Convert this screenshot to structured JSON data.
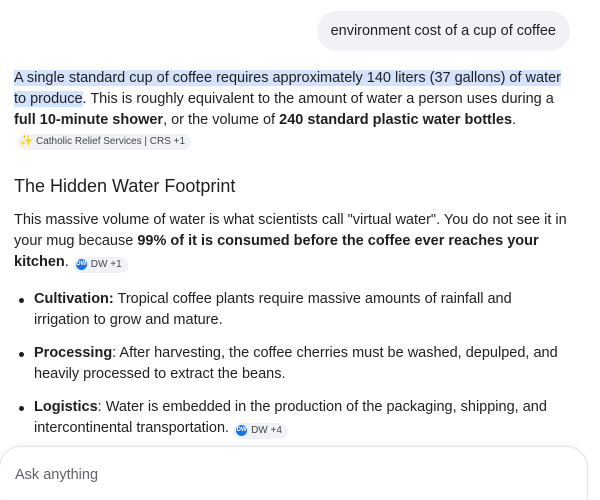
{
  "user_query": "environment cost of a cup of coffee",
  "answer": {
    "intro": {
      "highlight": "A single standard cup of coffee requires approximately 140 liters (37 gallons) of water to produce",
      "text1": ". This is roughly equivalent to the amount of water a person uses during a ",
      "bold1": "full 10-minute shower",
      "text2": ", or the volume of ",
      "bold2": "240 standard plastic water bottles",
      "text3": "."
    },
    "intro_citation": {
      "icon": "crs-icon",
      "label": "Catholic Relief Services | CRS +1"
    },
    "heading": "The Hidden Water Footprint",
    "para2": {
      "text1": "This massive volume of water is what scientists call \"virtual water\". You do not see it in your mug because ",
      "bold1": "99% of it is consumed before the coffee ever reaches your kitchen",
      "text2": "."
    },
    "para2_citation": {
      "icon": "dw-icon",
      "icon_text": "DW",
      "label": "DW +1"
    },
    "bullets": [
      {
        "term": "Cultivation:",
        "text": " Tropical coffee plants require massive amounts of rainfall and irrigation to grow and mature."
      },
      {
        "term": "Processing",
        "text": ": After harvesting, the coffee cherries must be washed, depulped, and heavily processed to extract the beans."
      },
      {
        "term": "Logistics",
        "text": ": Water is embedded in the production of the packaging, shipping, and intercontinental transportation."
      }
    ],
    "bullet3_citation": {
      "icon": "dw-icon",
      "icon_text": "DW",
      "label": "DW +4"
    }
  },
  "input": {
    "placeholder": "Ask anything",
    "value": ""
  }
}
